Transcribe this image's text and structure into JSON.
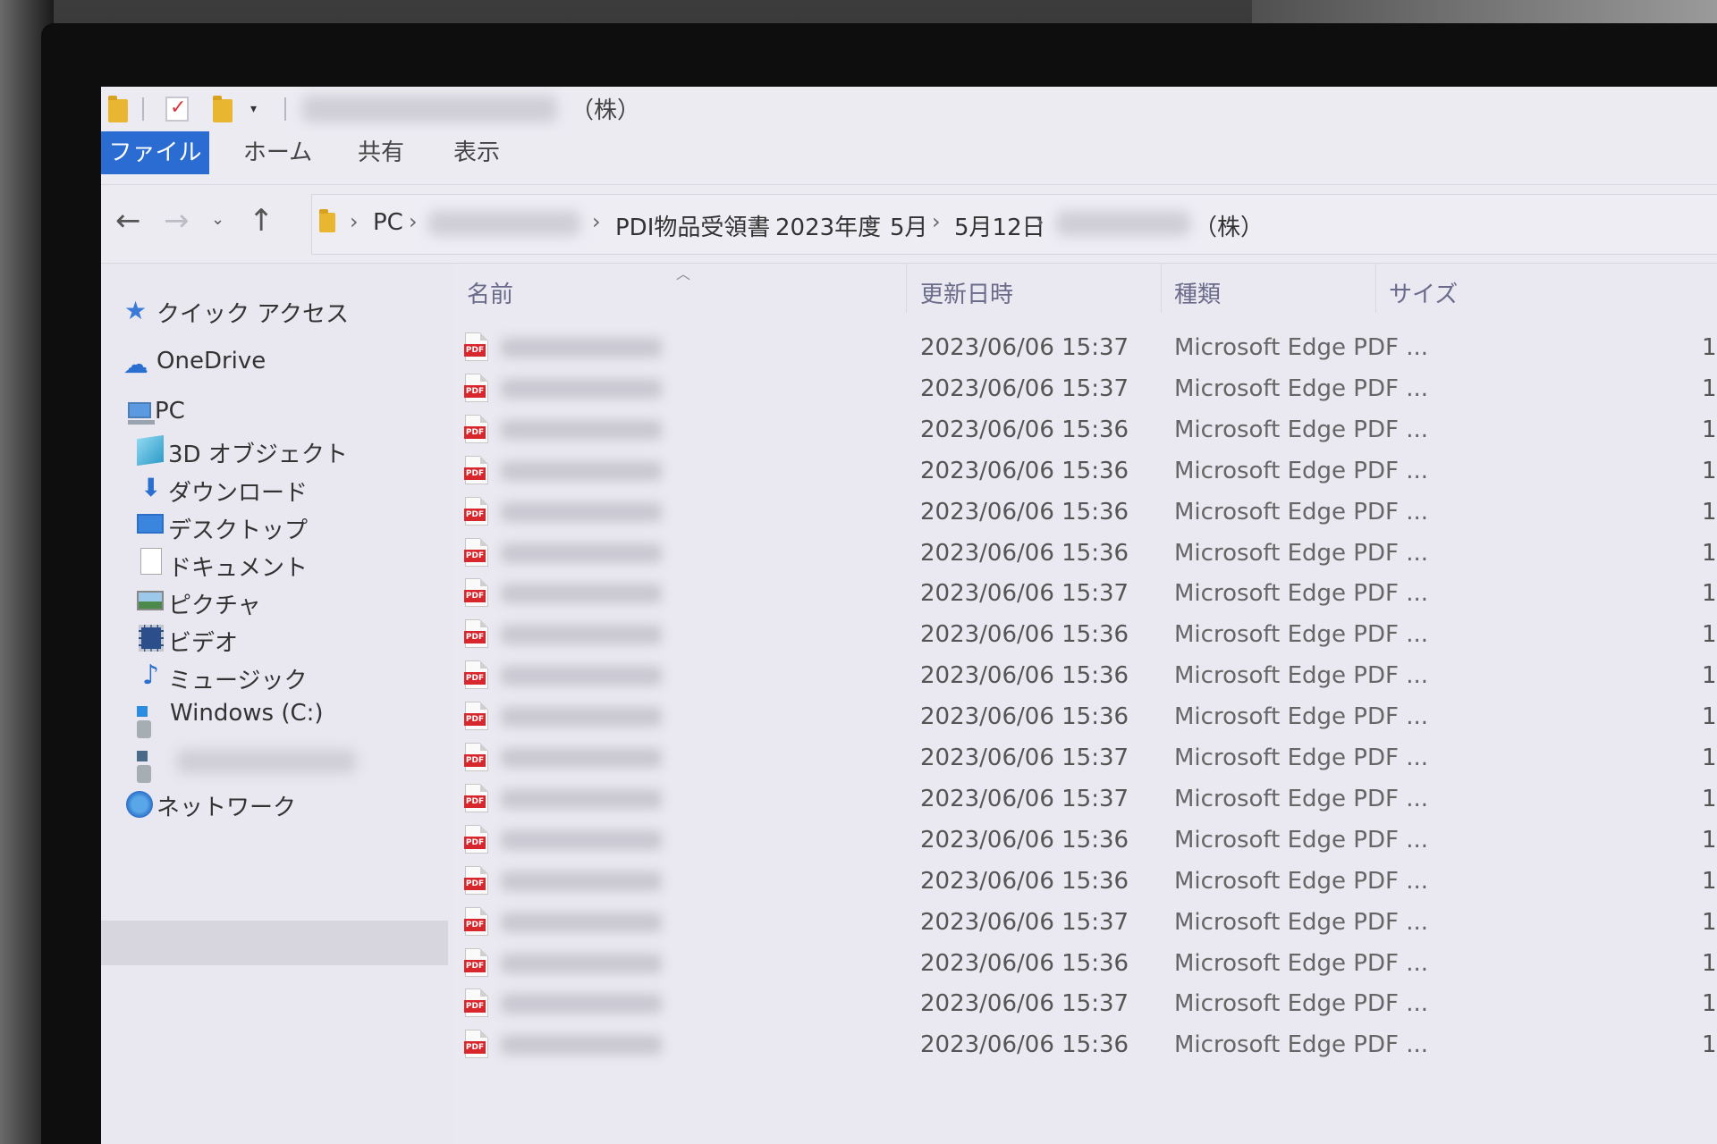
{
  "window": {
    "title_suffix": "（株）"
  },
  "ribbon": {
    "tabs": [
      "ファイル",
      "ホーム",
      "共有",
      "表示"
    ]
  },
  "address": {
    "crumbs": [
      "PC",
      "PDI物品受領書",
      "2023年度",
      "5月",
      "5月12日",
      "（株）"
    ]
  },
  "nav_pane": {
    "items": [
      {
        "label": "クイック アクセス",
        "icon": "star-icon"
      },
      {
        "label": "OneDrive",
        "icon": "cloud-icon"
      },
      {
        "label": "PC",
        "icon": "computer-icon"
      },
      {
        "label": "3D オブジェクト",
        "icon": "cube-icon"
      },
      {
        "label": "ダウンロード",
        "icon": "download-arrow-icon"
      },
      {
        "label": "デスクトップ",
        "icon": "desktop-icon"
      },
      {
        "label": "ドキュメント",
        "icon": "document-icon"
      },
      {
        "label": "ピクチャ",
        "icon": "picture-icon"
      },
      {
        "label": "ビデオ",
        "icon": "video-icon"
      },
      {
        "label": "ミュージック",
        "icon": "music-note-icon"
      },
      {
        "label": "Windows (C:)",
        "icon": "drive-icon"
      },
      {
        "label": "",
        "icon": "network-drive-icon"
      },
      {
        "label": "ネットワーク",
        "icon": "network-icon"
      }
    ],
    "selected_index": 11
  },
  "columns": {
    "name": "名前",
    "modified": "更新日時",
    "type": "種類",
    "size": "サイズ"
  },
  "files": [
    {
      "modified": "2023/06/06 15:37",
      "type": "Microsoft Edge PDF ...",
      "size": "1"
    },
    {
      "modified": "2023/06/06 15:37",
      "type": "Microsoft Edge PDF ...",
      "size": "1"
    },
    {
      "modified": "2023/06/06 15:36",
      "type": "Microsoft Edge PDF ...",
      "size": "1"
    },
    {
      "modified": "2023/06/06 15:36",
      "type": "Microsoft Edge PDF ...",
      "size": "1"
    },
    {
      "modified": "2023/06/06 15:36",
      "type": "Microsoft Edge PDF ...",
      "size": "1"
    },
    {
      "modified": "2023/06/06 15:36",
      "type": "Microsoft Edge PDF ...",
      "size": "1"
    },
    {
      "modified": "2023/06/06 15:37",
      "type": "Microsoft Edge PDF ...",
      "size": "1"
    },
    {
      "modified": "2023/06/06 15:36",
      "type": "Microsoft Edge PDF ...",
      "size": "1"
    },
    {
      "modified": "2023/06/06 15:36",
      "type": "Microsoft Edge PDF ...",
      "size": "1"
    },
    {
      "modified": "2023/06/06 15:36",
      "type": "Microsoft Edge PDF ...",
      "size": "1"
    },
    {
      "modified": "2023/06/06 15:37",
      "type": "Microsoft Edge PDF ...",
      "size": "1"
    },
    {
      "modified": "2023/06/06 15:37",
      "type": "Microsoft Edge PDF ...",
      "size": "1"
    },
    {
      "modified": "2023/06/06 15:36",
      "type": "Microsoft Edge PDF ...",
      "size": "1"
    },
    {
      "modified": "2023/06/06 15:36",
      "type": "Microsoft Edge PDF ...",
      "size": "1"
    },
    {
      "modified": "2023/06/06 15:37",
      "type": "Microsoft Edge PDF ...",
      "size": "1"
    },
    {
      "modified": "2023/06/06 15:36",
      "type": "Microsoft Edge PDF ...",
      "size": "1"
    },
    {
      "modified": "2023/06/06 15:37",
      "type": "Microsoft Edge PDF ...",
      "size": "1"
    },
    {
      "modified": "2023/06/06 15:36",
      "type": "Microsoft Edge PDF ...",
      "size": "1"
    }
  ],
  "file_icon_label": "PDF",
  "colors": {
    "accent": "#2b6cd2",
    "pdf_red": "#d8262d",
    "folder_yellow": "#e8b631"
  }
}
